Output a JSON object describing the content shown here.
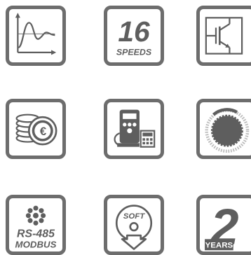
{
  "grid": {
    "tiles": [
      {
        "icon": "step-response-graph-icon"
      },
      {
        "icon": "speeds-badge-icon",
        "number": "16",
        "caption": "SPEEDS"
      },
      {
        "icon": "igbt-transistor-icon"
      },
      {
        "icon": "euro-coins-icon"
      },
      {
        "icon": "fuel-pump-meter-icon"
      },
      {
        "icon": "gear-dial-icon"
      },
      {
        "icon": "rs485-modbus-icon",
        "line1": "RS-485",
        "line2": "MODBUS"
      },
      {
        "icon": "soft-download-icon",
        "label": "SOFT"
      },
      {
        "icon": "two-years-warranty-icon",
        "number": "2",
        "label": "YEARS"
      }
    ]
  },
  "colors": {
    "border": "#6d6d6d",
    "ink": "#5e5e5e",
    "background": "#ffffff"
  }
}
